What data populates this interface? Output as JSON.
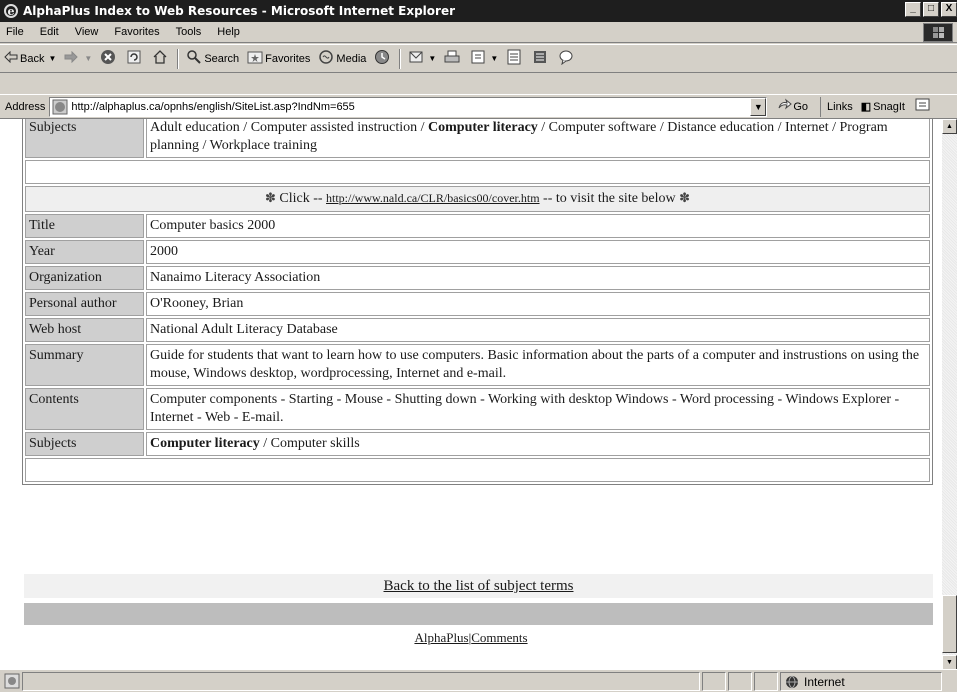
{
  "window": {
    "title": "AlphaPlus Index to Web Resources - Microsoft Internet Explorer",
    "controls": [
      "_",
      "□",
      "X"
    ]
  },
  "menu": [
    "File",
    "Edit",
    "View",
    "Favorites",
    "Tools",
    "Help"
  ],
  "toolbar": {
    "back_label": "Back",
    "search_label": "Search",
    "favorites_label": "Favorites",
    "media_label": "Media"
  },
  "address": {
    "label": "Address",
    "url": "http://alphaplus.ca/opnhs/english/SiteList.asp?IndNm=655",
    "go_label": "Go",
    "links_label": "Links",
    "snagit_label": "SnagIt"
  },
  "page": {
    "prev_subjects": {
      "label": "Subjects",
      "before": "Adult education / Computer assisted instruction / ",
      "bold": "Computer literacy",
      "after": " / Computer software / Distance education / Internet / Program planning / Workplace training"
    },
    "click_row": {
      "prefix": "Click -- ",
      "url": "http://www.nald.ca/CLR/basics00/cover.htm",
      "suffix": " -- to visit the site below"
    },
    "rows": [
      {
        "label": "Title",
        "value": "Computer basics 2000"
      },
      {
        "label": "Year",
        "value": "2000"
      },
      {
        "label": "Organization",
        "value": "Nanaimo Literacy Association"
      },
      {
        "label": "Personal author",
        "value": "O'Rooney, Brian"
      },
      {
        "label": "Web host",
        "value": "National Adult Literacy Database"
      },
      {
        "label": "Summary",
        "value": "Guide for students that want to learn how to use computers. Basic information about the parts of a computer and instrustions on using the mouse, Windows desktop, wordprocessing, Internet and e-mail."
      },
      {
        "label": "Contents",
        "value": "Computer components - Starting - Mouse - Shutting down - Working with desktop Windows - Word processing - Windows Explorer - Internet - Web - E-mail."
      }
    ],
    "subjects": {
      "label": "Subjects",
      "bold": "Computer literacy",
      "after": " / Computer skills"
    },
    "back_link": "Back to the list of subject terms",
    "footer": {
      "alphaplus": "AlphaPlus",
      "sep": "|",
      "comments": "Comments"
    }
  },
  "status": {
    "zone": "Internet"
  }
}
